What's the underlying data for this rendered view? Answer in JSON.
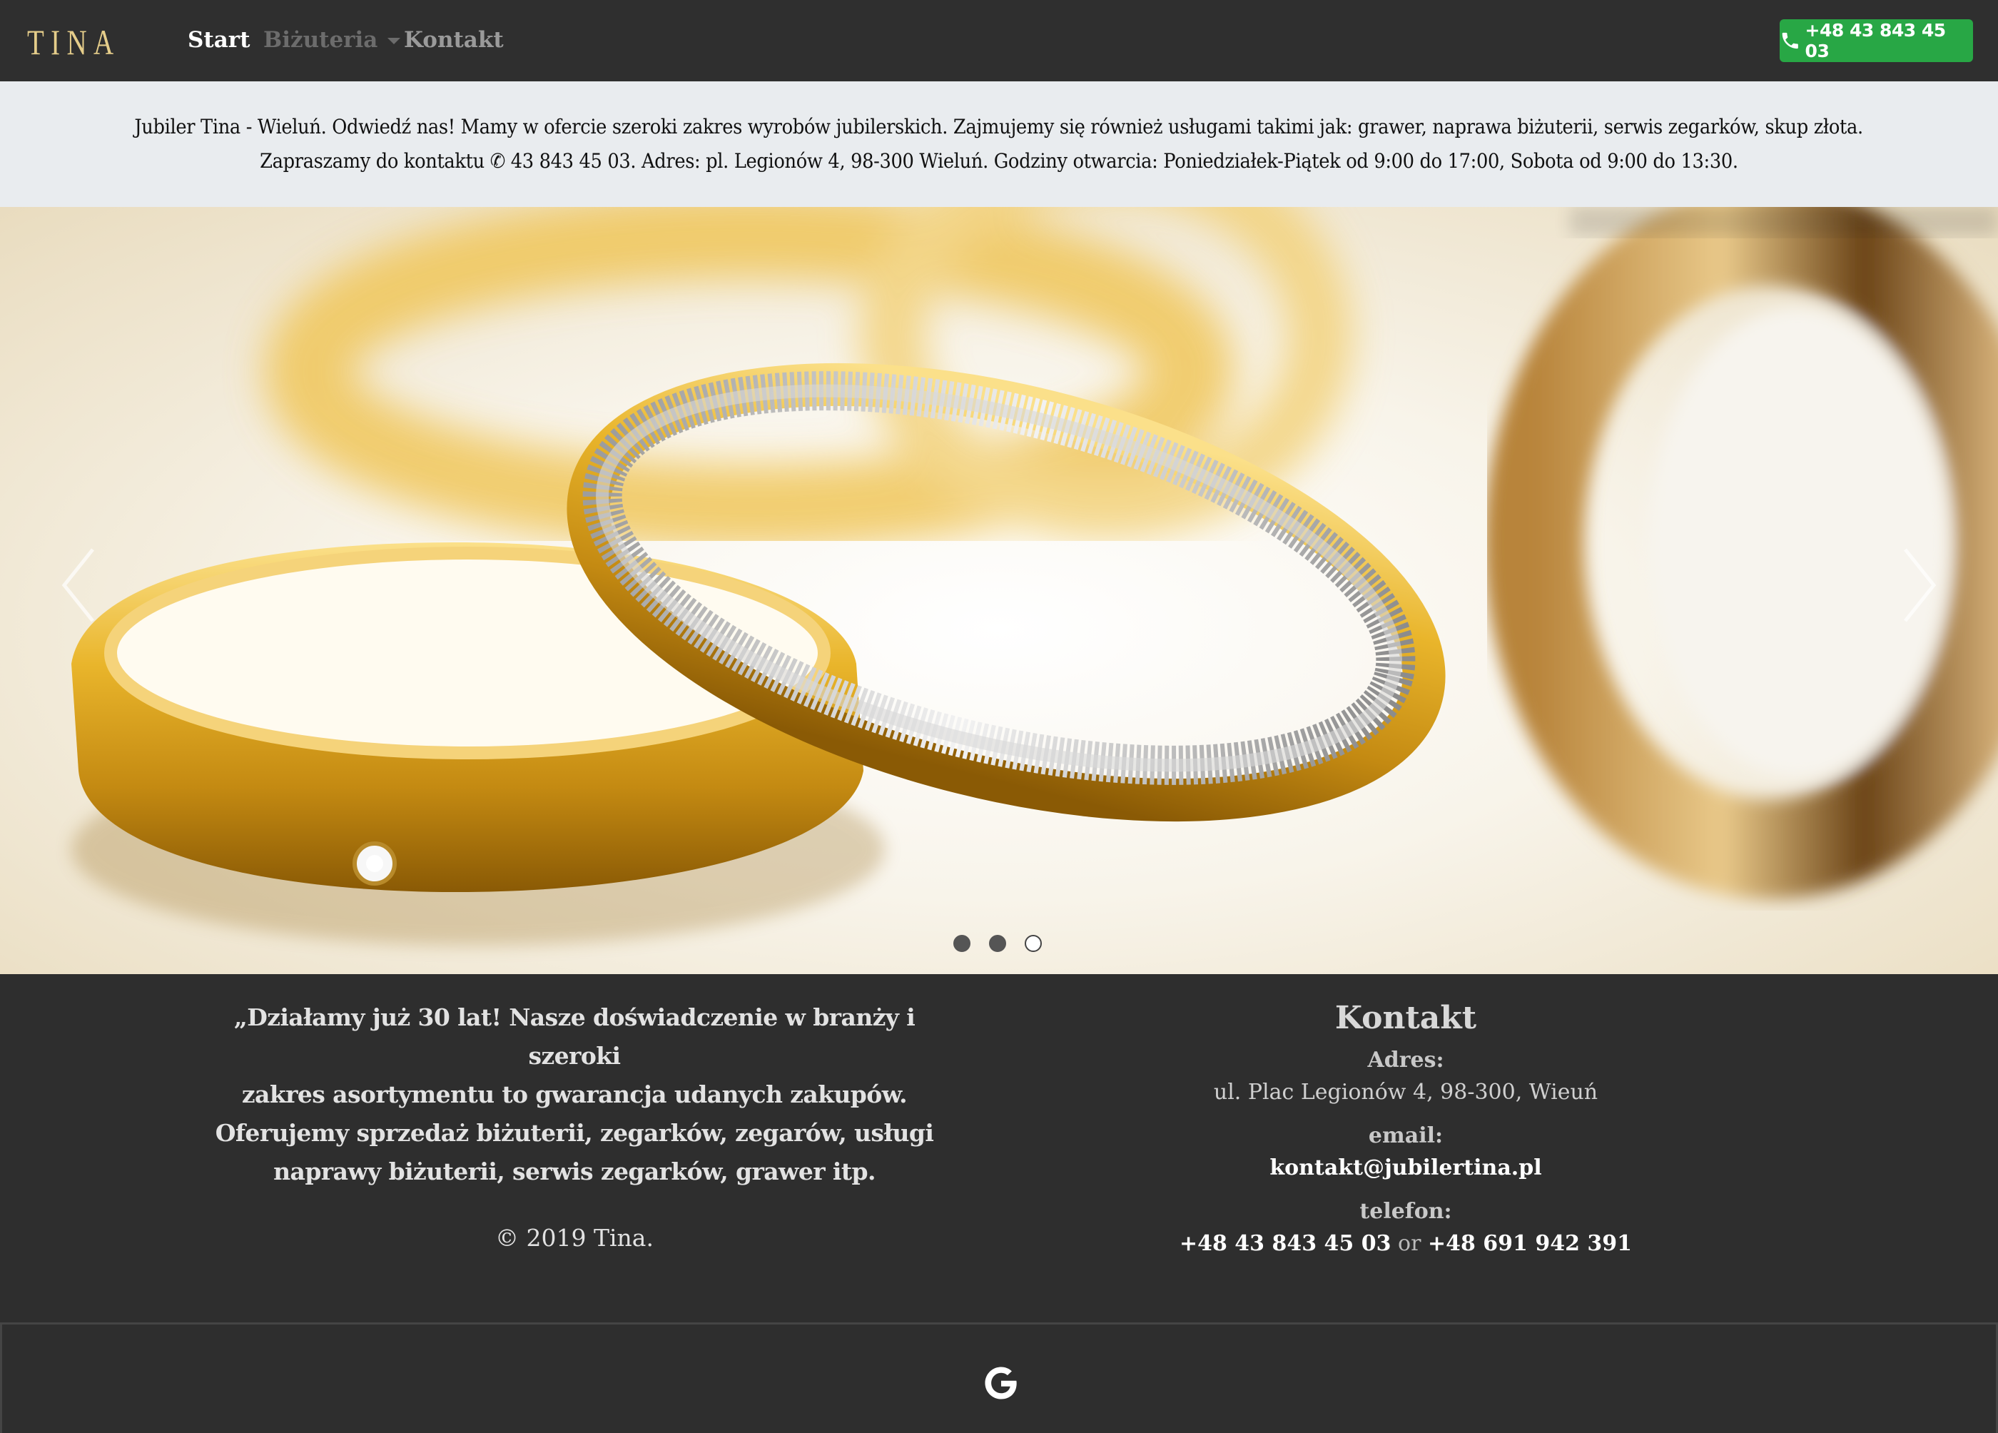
{
  "nav": {
    "brand": "TINA",
    "links": [
      {
        "label": "Start",
        "state": "active"
      },
      {
        "label": "Biżuteria",
        "state": "dropdown"
      },
      {
        "label": "Kontakt",
        "state": "normal"
      }
    ],
    "phone_button": {
      "label": "+48 43 843 45 03",
      "icon": "phone-icon",
      "color": "#28a745"
    }
  },
  "info": {
    "line1": "Jubiler Tina - Wieluń. Odwiedź nas! Mamy w ofercie szeroki zakres wyrobów jubilerskich. Zajmujemy się również usługami takimi jak: grawer, naprawa biżuterii, serwis zegarków, skup złota.",
    "line2": "Zapraszamy do kontaktu ✆ 43 843 45 03. Adres: pl. Legionów 4, 98-300 Wieluń. Godziny otwarcia: Poniedziałek-Piątek od 9:00 do 17:00, Sobota od 9:00 do 13:30."
  },
  "carousel": {
    "image": "gold-wedding-rings-photo",
    "prev_icon": "chevron-left-icon",
    "next_icon": "chevron-right-icon",
    "slide_count": 3,
    "active_index": 2
  },
  "footer": {
    "about_lines": [
      "„Działamy już 30 lat! Nasze doświadczenie w branży i szeroki",
      "zakres asortymentu to gwarancja udanych zakupów.",
      "Oferujemy sprzedaż biżuterii, zegarków, zegarów, usługi",
      "naprawy biżuterii, serwis zegarków, grawer itp."
    ],
    "copyright": "©  2019 Tina.",
    "contact": {
      "title": "Kontakt",
      "address_label": "Adres:",
      "address_value": "ul. Plac Legionów 4, 98-300, Wieuń",
      "email_label": "email:",
      "email_value": "kontakt@jubilertina.pl",
      "phone_label": "telefon:",
      "phone_1": "+48 43 843 45 03",
      "phone_or": " or ",
      "phone_2": "+48 691 942 391"
    }
  },
  "bottom": {
    "icon": "google-icon"
  }
}
